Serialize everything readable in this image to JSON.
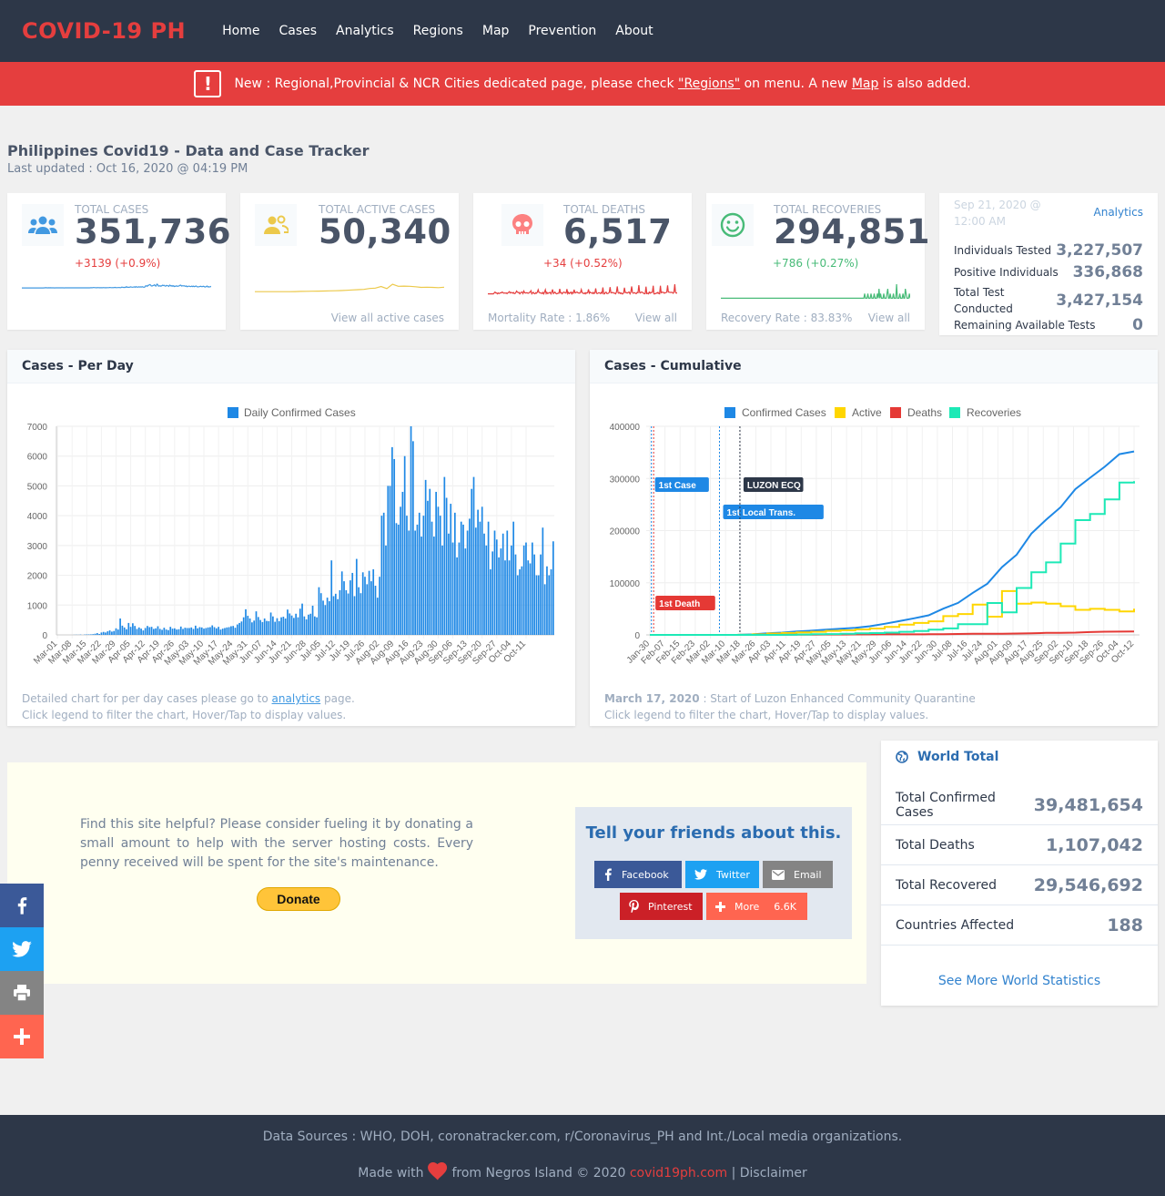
{
  "nav": {
    "brand": "COVID-19 PH",
    "links": [
      "Home",
      "Cases",
      "Analytics",
      "Regions",
      "Map",
      "Prevention",
      "About"
    ]
  },
  "alert": {
    "icon": "exclamation-icon",
    "prefix": "New : Regional,Provincial & NCR Cities dedicated page, please check ",
    "regions_link": "\"Regions\"",
    "middle": " on menu. A new ",
    "map_link": "Map",
    "suffix": " is also added."
  },
  "header": {
    "title": "Philippines Covid19 - Data and Case Tracker",
    "updated": "Last updated : Oct 16, 2020 @ 04:19 PM"
  },
  "stats": {
    "total_cases": {
      "label": "TOTAL CASES",
      "value": "351,736",
      "change": "+3139 (+0.9%)",
      "color": "#4299e1"
    },
    "active": {
      "label": "TOTAL ACTIVE CASES",
      "value": "50,340",
      "footer": "View all active cases",
      "color": "#ecc94b"
    },
    "deaths": {
      "label": "TOTAL DEATHS",
      "value": "6,517",
      "change": "+34 (+0.52%)",
      "rate": "Mortality Rate : 1.86%",
      "view": "View all",
      "color": "#e53e3e"
    },
    "recoveries": {
      "label": "TOTAL RECOVERIES",
      "value": "294,851",
      "change": "+786 (+0.27%)",
      "rate": "Recovery Rate : 83.83%",
      "view": "View all",
      "color": "#48bb78"
    }
  },
  "tests": {
    "date": "Sep 21, 2020 @ 12:00 AM",
    "link": "Analytics",
    "rows": [
      {
        "label": "Individuals Tested",
        "value": "3,227,507"
      },
      {
        "label": "Positive Individuals",
        "value": "336,868"
      },
      {
        "label": "Total Test Conducted",
        "value": "3,427,154"
      },
      {
        "label": "Remaining Available Tests",
        "value": "0"
      }
    ]
  },
  "per_day": {
    "title": "Cases - Per Day",
    "foot_prefix": "Detailed chart for per day cases please go to ",
    "foot_link": "analytics",
    "foot_suffix": " page.",
    "foot_line2": "Click legend to filter the chart, Hover/Tap to display values."
  },
  "cumulative": {
    "title": "Cases - Cumulative",
    "foot_date": "March 17, 2020",
    "foot_text": " : Start of Luzon Enhanced Community Quarantine",
    "foot_line2": "Click legend to filter the chart, Hover/Tap to display values."
  },
  "chart_data": [
    {
      "type": "bar",
      "legend": [
        "Daily Confirmed Cases"
      ],
      "colors": [
        "#1e88e5"
      ],
      "ylim": [
        0,
        7000
      ],
      "yticks": [
        0,
        1000,
        2000,
        3000,
        4000,
        5000,
        6000,
        7000
      ],
      "xticks": [
        "Mar-01",
        "Mar-08",
        "Mar-15",
        "Mar-22",
        "Mar-29",
        "Apr-05",
        "Apr-12",
        "Apr-19",
        "Apr-26",
        "May-03",
        "May-10",
        "May-17",
        "May-24",
        "May-31",
        "Jun-07",
        "Jun-14",
        "Jun-21",
        "Jun-28",
        "Jul-05",
        "Jul-12",
        "Jul-19",
        "Jul-26",
        "Aug-02",
        "Aug-09",
        "Aug-16",
        "Aug-23",
        "Aug-30",
        "Sep-06",
        "Sep-13",
        "Sep-20",
        "Sep-27",
        "Oct-04",
        "Oct-11"
      ],
      "series": [
        {
          "name": "Daily Confirmed Cases",
          "values": [
            0,
            0,
            0,
            0,
            0,
            0,
            0,
            0,
            3,
            5,
            3,
            10,
            0,
            10,
            15,
            16,
            18,
            24,
            39,
            60,
            30,
            80,
            100,
            80,
            120,
            150,
            110,
            130,
            220,
            180,
            550,
            310,
            250,
            190,
            400,
            270,
            390,
            300,
            200,
            250,
            210,
            150,
            230,
            300,
            260,
            270,
            200,
            220,
            290,
            200,
            170,
            240,
            180,
            160,
            270,
            210,
            220,
            180,
            190,
            280,
            200,
            240,
            230,
            230,
            250,
            200,
            310,
            220,
            260,
            250,
            210,
            230,
            250,
            260,
            320,
            260,
            220,
            270,
            180,
            210,
            230,
            250,
            260,
            290,
            300,
            240,
            350,
            400,
            450,
            590,
            860,
            640,
            550,
            420,
            480,
            790,
            600,
            500,
            430,
            550,
            470,
            460,
            750,
            620,
            440,
            560,
            460,
            590,
            610,
            550,
            850,
            720,
            650,
            570,
            710,
            590,
            880,
            1050,
            620,
            520,
            680,
            710,
            980,
            620,
            590,
            1600,
            1400,
            1150,
            1000,
            1250,
            1130,
            2500,
            1300,
            1380,
            1200,
            1500,
            2130,
            1800,
            1500,
            1390,
            1830,
            2080,
            1300,
            2550,
            1600,
            1400,
            2100,
            1950,
            1700,
            2150,
            1800,
            2200,
            1650,
            1250,
            1950,
            4000,
            4100,
            3000,
            5000,
            5000,
            6300,
            5900,
            3750,
            3700,
            4300,
            4800,
            6000,
            4000,
            3500,
            7000,
            6500,
            3500,
            3700,
            4100,
            3300,
            4000,
            5200,
            4500,
            4900,
            3800,
            3300,
            4800,
            4300,
            4000,
            3000,
            5300,
            4600,
            3400,
            4400,
            3100,
            4100,
            2600,
            3100,
            3800,
            3700,
            2900,
            3500,
            3900,
            4900,
            5300,
            3600,
            4200,
            3800,
            4300,
            3400,
            3000,
            3800,
            2200,
            2800,
            3500,
            3200,
            2600,
            2900,
            3400,
            2500,
            3500,
            2500,
            3000,
            3800,
            2700,
            2000,
            2200,
            2300,
            3000,
            3100,
            2500,
            2400,
            3100,
            2700,
            2000,
            2000,
            2700,
            3600,
            1700,
            2300,
            2000,
            2200,
            3140
          ]
        }
      ]
    },
    {
      "type": "line",
      "legend": [
        "Confirmed Cases",
        "Active",
        "Deaths",
        "Recoveries"
      ],
      "colors": [
        "#1e88e5",
        "#ffd600",
        "#e53935",
        "#1de9b6"
      ],
      "ylim": [
        0,
        400000
      ],
      "yticks": [
        0,
        100000,
        200000,
        300000,
        400000
      ],
      "xticks": [
        "Jan-30",
        "Feb-07",
        "Feb-15",
        "Feb-23",
        "Mar-02",
        "Mar-10",
        "Mar-18",
        "Mar-26",
        "Apr-03",
        "Apr-11",
        "Apr-19",
        "Apr-27",
        "May-05",
        "May-13",
        "May-21",
        "May-29",
        "Jun-06",
        "Jun-14",
        "Jun-22",
        "Jun-30",
        "Jul-08",
        "Jul-16",
        "Jul-24",
        "Aug-01",
        "Aug-09",
        "Aug-17",
        "Aug-25",
        "Sep-02",
        "Sep-10",
        "Sep-18",
        "Sep-26",
        "Oct-04",
        "Oct-12"
      ],
      "series": [
        {
          "name": "Confirmed Cases",
          "values": [
            1,
            3,
            3,
            3,
            3,
            33,
            202,
            1075,
            3018,
            4428,
            6459,
            7958,
            10004,
            11618,
            13434,
            16634,
            21340,
            26420,
            31825,
            37514,
            50359,
            61266,
            80448,
            98232,
            129913,
            153660,
            194252,
            220819,
            245143,
            279526,
            301256,
            322497,
            346536,
            351736
          ]
        },
        {
          "name": "Active",
          "values": [
            1,
            2,
            1,
            1,
            1,
            31,
            194,
            1010,
            2700,
            3600,
            4950,
            6000,
            7600,
            8700,
            10500,
            12300,
            15200,
            19500,
            22800,
            26000,
            36000,
            40000,
            58000,
            35000,
            84000,
            60000,
            62000,
            60000,
            55000,
            48000,
            50000,
            48000,
            45000,
            50340
          ]
        },
        {
          "name": "Deaths",
          "values": [
            0,
            1,
            1,
            1,
            1,
            0,
            17,
            68,
            136,
            247,
            428,
            530,
            658,
            751,
            886,
            950,
            1027,
            1074,
            1116,
            1266,
            1314,
            1660,
            2023,
            2104,
            2150,
            2600,
            3010,
            3790,
            4006,
            4280,
            5448,
            6069,
            6332,
            6517
          ]
        },
        {
          "name": "Recoveries",
          "values": [
            0,
            0,
            1,
            2,
            2,
            2,
            8,
            57,
            71,
            157,
            654,
            1324,
            1506,
            2251,
            3018,
            3412,
            4330,
            5954,
            7378,
            9956,
            12386,
            20371,
            20459,
            61111,
            43214,
            90000,
            120000,
            139000,
            175000,
            220000,
            232000,
            260000,
            292000,
            294851
          ]
        }
      ],
      "annotations": [
        {
          "label": "1st Case",
          "date": "Jan-30",
          "color": "#1e88e5"
        },
        {
          "label": "1st Death",
          "date": "Feb-01",
          "color": "#e53935"
        },
        {
          "label": "1st Local Trans.",
          "date": "Mar-07",
          "color": "#1e88e5"
        },
        {
          "label": "LUZON ECQ",
          "date": "Mar-17",
          "color": "#2d3748"
        }
      ]
    }
  ],
  "donate": {
    "text": "Find this site helpful? Please consider fueling it by donating a small amount to help with the server hosting costs. Every penny received will be spent for the site's maintenance.",
    "button": "Donate"
  },
  "share": {
    "title": "Tell your friends about this.",
    "facebook": "Facebook",
    "twitter": "Twitter",
    "email": "Email",
    "pinterest": "Pinterest",
    "more": "More",
    "more_count": "6.6K"
  },
  "world": {
    "title": "World Total",
    "rows": [
      {
        "label": "Total Confirmed Cases",
        "value": "39,481,654"
      },
      {
        "label": "Total Deaths",
        "value": "1,107,042"
      },
      {
        "label": "Total Recovered",
        "value": "29,546,692"
      },
      {
        "label": "Countries Affected",
        "value": "188"
      }
    ],
    "link": "See More World Statistics"
  },
  "side_share": [
    "facebook-icon",
    "twitter-icon",
    "print-icon",
    "plus-icon"
  ],
  "footer": {
    "sources": "Data Sources : WHO, DOH, coronatracker.com, r/Coronavirus_PH and Int./Local media organizations.",
    "made_with": "Made with",
    "from": "from Negros Island © 2020",
    "site": "covid19ph.com",
    "sep": "|",
    "disclaimer": "Disclaimer"
  }
}
